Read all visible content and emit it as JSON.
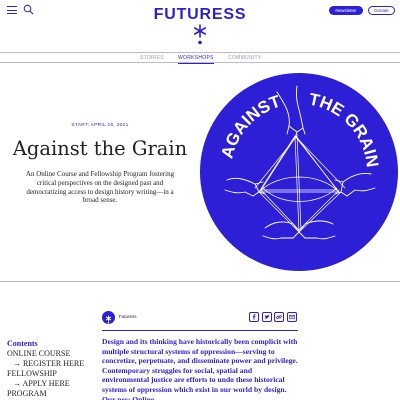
{
  "header": {
    "logo_text": "FUTURESS",
    "newsletter_label": "Newsletter",
    "donate_label": "Donate"
  },
  "nav": {
    "items": [
      {
        "label": "STORIES"
      },
      {
        "label": "WORKSHOPS",
        "active": true
      },
      {
        "label": "COMMUNITY"
      }
    ]
  },
  "hero": {
    "start_date": "START: APRIL 16, 2021",
    "title": "Against the Grain",
    "description": "An Online Course and Fellowship Program fostering critical perspectives on the designed past and democratizing access to design history writing—in a broad sense.",
    "art": {
      "text_left": "AGAINST",
      "text_right": "THE GRAIN",
      "color": "#2d1fd6"
    }
  },
  "byline": {
    "org_name": "Futuress"
  },
  "toc": {
    "title": "Contents",
    "items": [
      "ONLINE COURSE",
      "→ REGISTER HERE",
      "FELLOWSHIP",
      "→ APPLY HERE",
      "PROGRAM"
    ]
  },
  "article": {
    "intro": "Design and its thinking have historically been complicit with multiple structural systems of oppression—serving to concretize, perpetuate, and disseminate power and privilege. Contemporary struggles for social, spatial and environmental justice are efforts to undo these historical systems of oppression which exist in our world by design. Our new Online"
  },
  "colors": {
    "brand": "#2d1fd6",
    "divider": "#bdb6f0"
  }
}
